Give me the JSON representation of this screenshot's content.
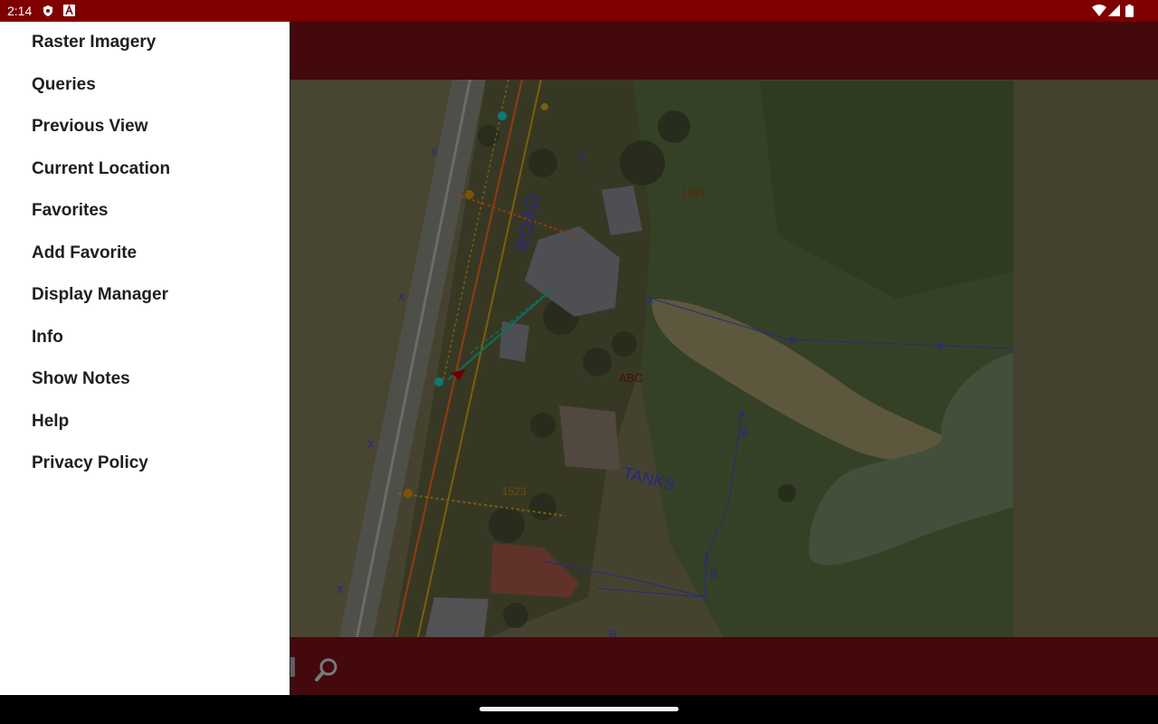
{
  "status_bar": {
    "time": "2:14",
    "icons": [
      "shield-notification-icon",
      "a-notification-icon",
      "wifi-icon",
      "signal-icon",
      "battery-icon"
    ]
  },
  "drawer": {
    "items": [
      {
        "label": "Raster Imagery"
      },
      {
        "label": "Queries"
      },
      {
        "label": "Previous View"
      },
      {
        "label": "Current Location"
      },
      {
        "label": "Favorites"
      },
      {
        "label": "Add Favorite"
      },
      {
        "label": "Display Manager"
      },
      {
        "label": "Info"
      },
      {
        "label": "Show Notes"
      },
      {
        "label": "Help"
      },
      {
        "label": "Privacy Policy"
      }
    ]
  },
  "map": {
    "labels": {
      "road": "ROAD",
      "tanks": "TANKS",
      "address_1521": "1521",
      "address_1523": "1523",
      "abc": "ABC",
      "building_b1": "B",
      "building_b2": "B",
      "building_b3": "B"
    }
  },
  "bottom_bar": {
    "tools": [
      "toolbar-icon",
      "search-icon"
    ]
  },
  "colors": {
    "status_bar": "#7f0000",
    "app_bar": "#4d0b0f",
    "drawer_bg": "#ffffff",
    "drawer_text": "#1f1f1f"
  }
}
